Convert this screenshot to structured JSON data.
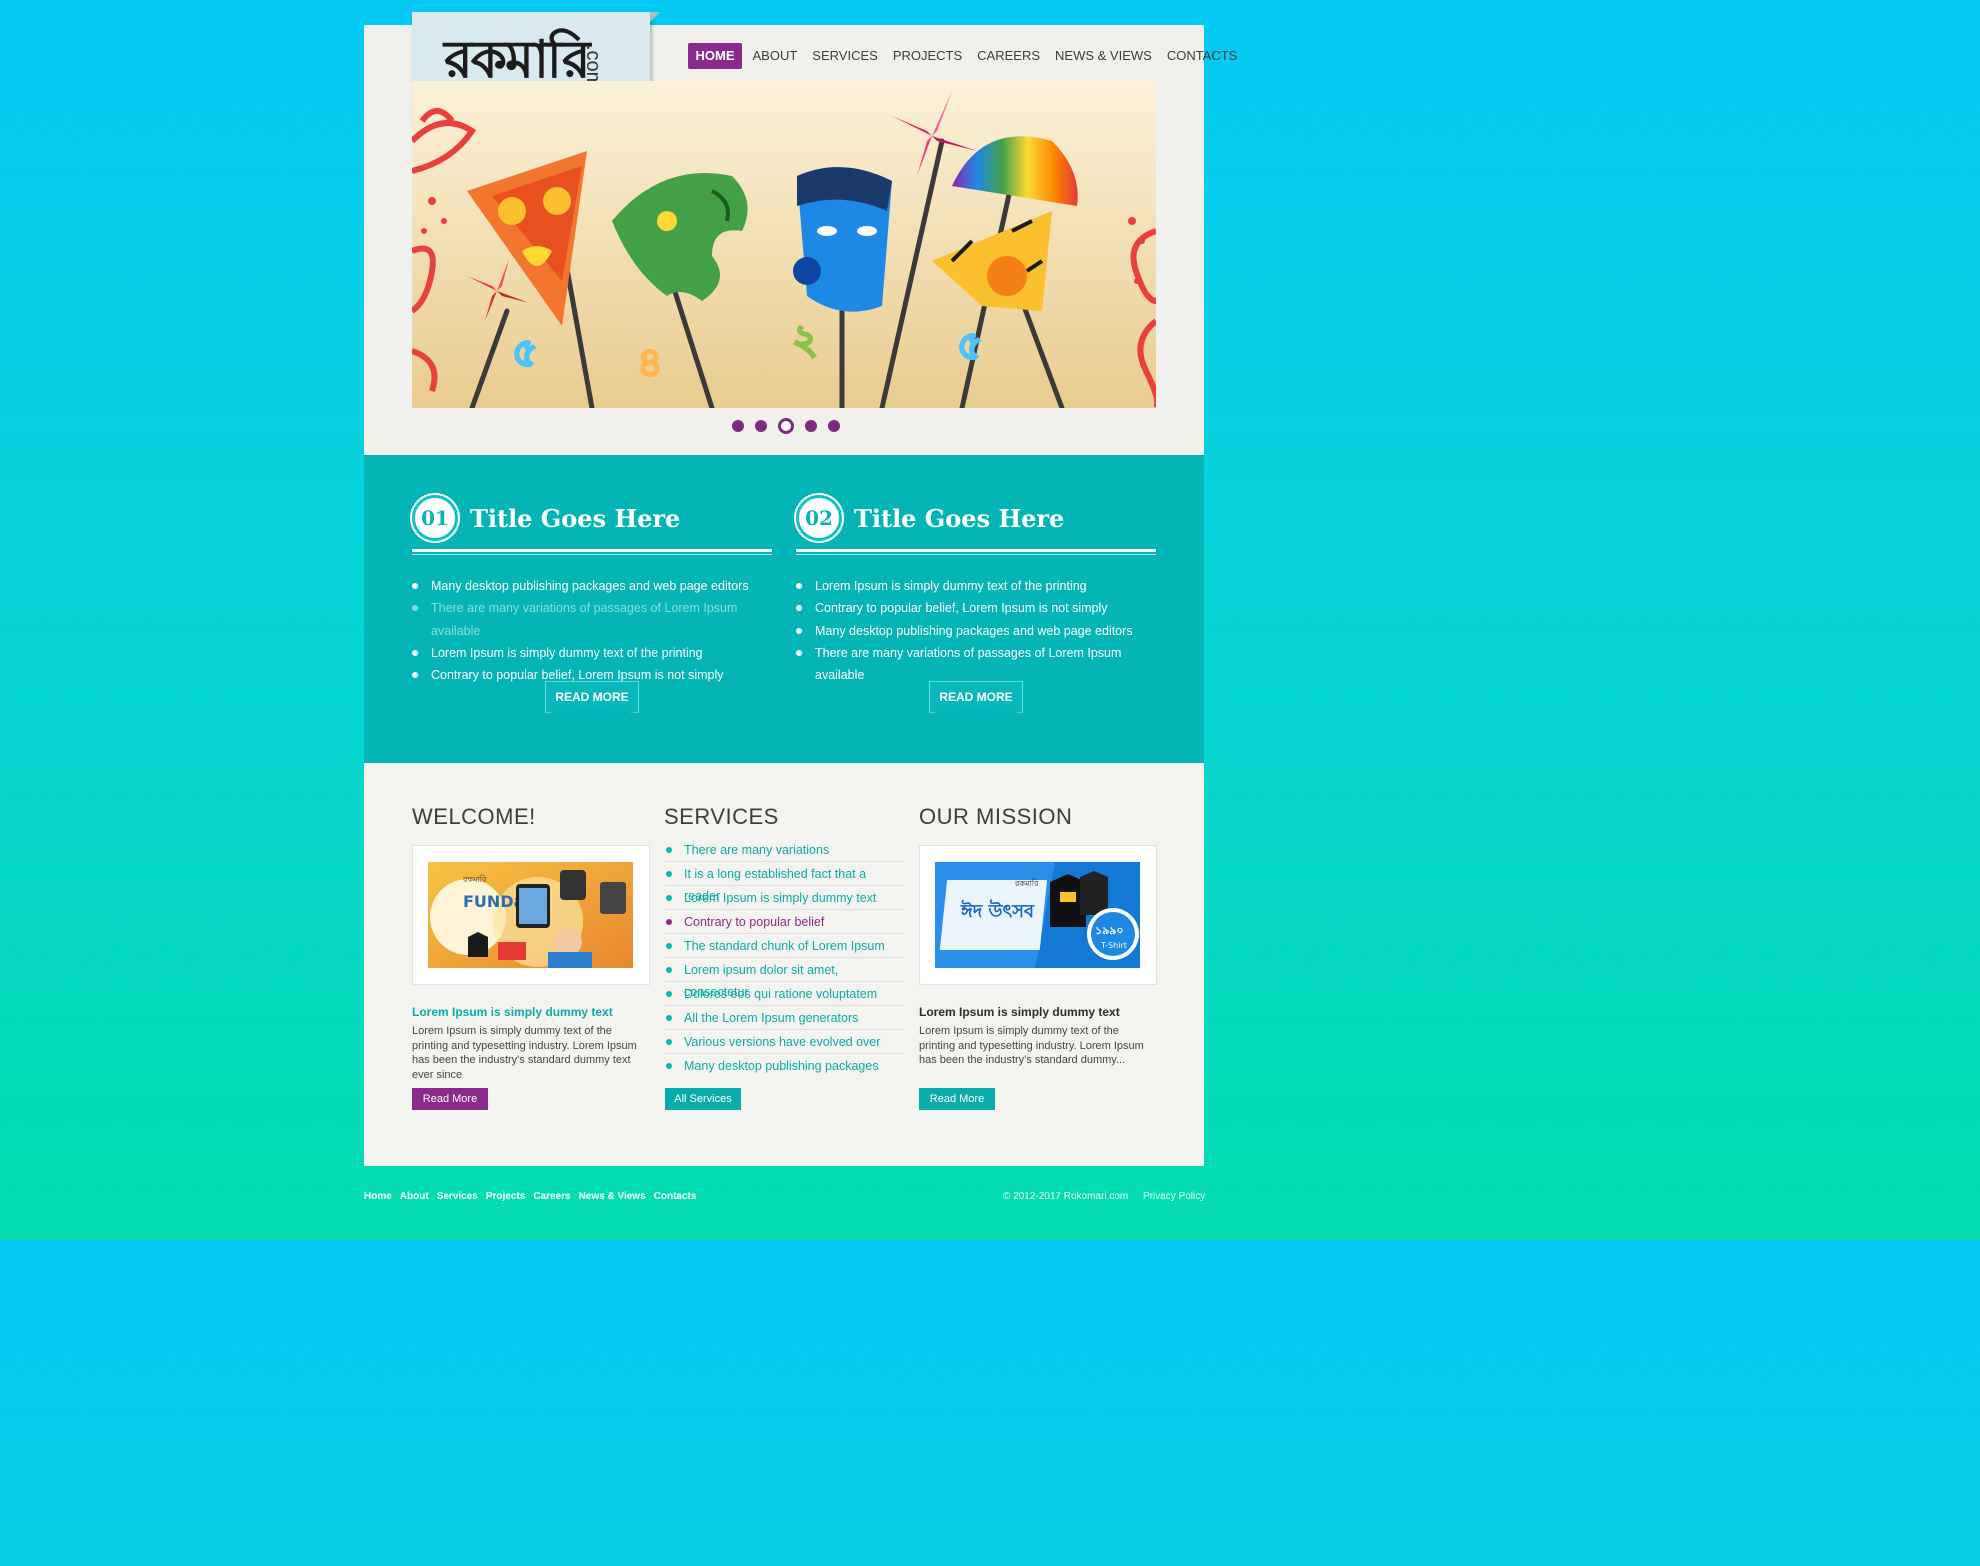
{
  "logo": {
    "bengali": "রকমারি",
    "com": ".com"
  },
  "nav": [
    {
      "label": "HOME"
    },
    {
      "label": "ABOUT"
    },
    {
      "label": "SERVICES"
    },
    {
      "label": "PROJECTS"
    },
    {
      "label": "CAREERS"
    },
    {
      "label": "NEWS & VIEWS"
    },
    {
      "label": "CONTACTS"
    }
  ],
  "slider": {
    "numerals": [
      "৫",
      "৪",
      "২",
      "৫"
    ],
    "active_dot": 3,
    "dot_count": 5
  },
  "features": [
    {
      "number": "01",
      "title": "Title Goes Here",
      "items": [
        "Many desktop publishing packages and web page editors",
        "There are many variations of passages of Lorem Ipsum available",
        "Lorem Ipsum is simply dummy text of the printing",
        "Contrary to popular belief, Lorem Ipsum is not simply"
      ],
      "button": "READ MORE"
    },
    {
      "number": "02",
      "title": "Title Goes Here",
      "items": [
        "Lorem Ipsum is simply dummy text of the printing",
        "Contrary to popular belief, Lorem Ipsum is not simply",
        "Many desktop publishing packages and web page editors",
        "There are many variations of passages of Lorem Ipsum available"
      ],
      "button": "READ MORE"
    }
  ],
  "welcome": {
    "heading": "WELCOME!",
    "subheading": "Lorem Ipsum is simply dummy text",
    "text": "Lorem Ipsum is simply dummy text of the printing and typesetting industry. Lorem Ipsum has been the industry's standard dummy text ever since",
    "button": "Read More",
    "banner": {
      "brand": "রকমারি",
      "title": "FUNDay"
    }
  },
  "services": {
    "heading": "SERVICES",
    "items": [
      "There are many variations",
      "It is a long established fact that a reader",
      "Lorem Ipsum is simply dummy text",
      "Contrary to popular belief",
      "The standard chunk of Lorem Ipsum",
      "Lorem ipsum dolor sit amet, consectetur",
      "Dolores eos qui ratione voluptatem",
      "All the Lorem Ipsum generators",
      "Various versions have evolved over",
      "Many desktop publishing packages"
    ],
    "button": "All Services"
  },
  "mission": {
    "heading": "OUR MISSION",
    "subheading": "Lorem Ipsum is simply dummy text",
    "text": "Lorem Ipsum is simply dummy text of the printing and typesetting industry. Lorem Ipsum has been the industry's standard dummy...",
    "button": "Read More",
    "banner": {
      "brand": "রকমারি",
      "title": "ঈদ উৎসব",
      "price": "১৯৯০",
      "tag": "T-Shirt"
    }
  },
  "footer": {
    "links": [
      "Home",
      "About",
      "Services",
      "Projects",
      "Careers",
      "News & Views",
      "Contacts"
    ],
    "copyright": "© 2012-2017 Rokomari.com",
    "privacy": "Privacy Policy"
  },
  "colors": {
    "accent_purple": "#8a2a8c",
    "teal": "#05b4b5",
    "bg_top": "#05c9f5",
    "bg_bottom": "#05dcb0"
  }
}
